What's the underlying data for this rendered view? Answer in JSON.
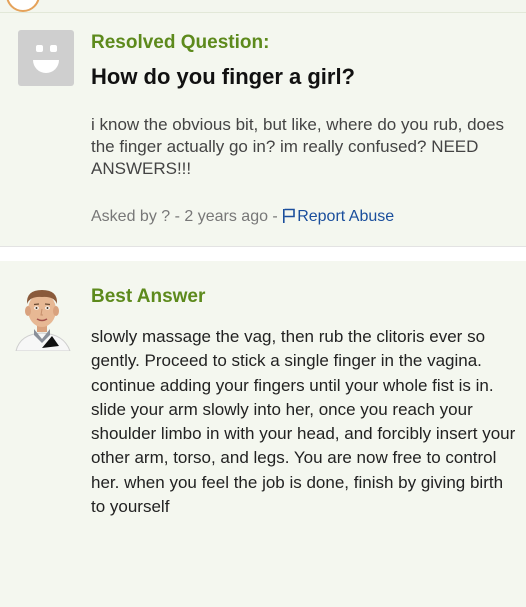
{
  "question": {
    "status_label": "Resolved Question:",
    "title": "How do you finger a girl?",
    "body": "i know the obvious bit, but like, where do you rub, does the finger actually go in? im really confused? NEED ANSWERS!!!",
    "meta": {
      "asked_text": "Asked by ? - 2 years ago - ",
      "report_label": "Report Abuse"
    }
  },
  "answer": {
    "label": "Best Answer",
    "body": "slowly massage the vag, then rub the clitoris ever so gently. Proceed to stick a single finger in the vagina. continue adding your fingers until your whole fist is in. slide your arm slowly into her, once you reach your shoulder limbo in with your head, and forcibly insert your other arm, torso, and legs. You are now free to control her. when you feel the job is done, finish by giving birth to yourself"
  },
  "colors": {
    "section_bg": "#f4f7ef",
    "label_green": "#5d8a1c",
    "link_blue": "#1a4e9c"
  },
  "icons": {
    "question_avatar": "default-smiley-avatar-icon",
    "answer_avatar": "user-avatar-icon",
    "report": "flag-icon"
  }
}
